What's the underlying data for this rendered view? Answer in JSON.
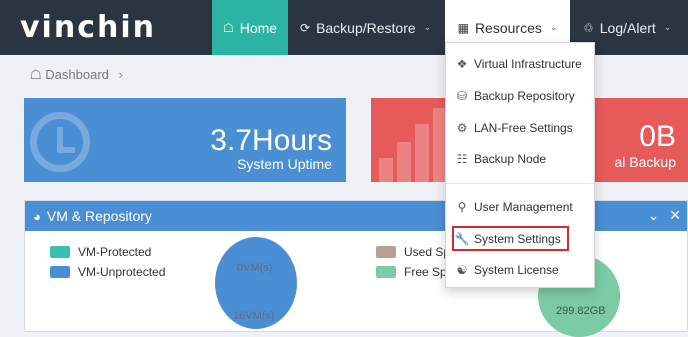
{
  "brand": {
    "logo": "vinchin"
  },
  "nav": {
    "home": "Home",
    "backup_restore": "Backup/Restore",
    "resources": "Resources",
    "log_alert": "Log/Alert"
  },
  "breadcrumb": {
    "item": "Dashboard"
  },
  "tiles": {
    "uptime_value": "3.7Hours",
    "uptime_label": "System Uptime",
    "backup_value": "0B",
    "backup_label": "al Backup"
  },
  "panel": {
    "title": "VM & Repository",
    "legend": {
      "protected": "VM-Protected",
      "unprotected": "VM-Unprotected",
      "used": "Used Sp",
      "free": "Free Spa"
    },
    "vm_protected_count": "0VM(s)",
    "vm_unprotected_count": "16VM(s)",
    "free_space": "299.82GB",
    "colors": {
      "protected": "#3bbfae",
      "unprotected": "#4a8ed3",
      "used": "#b79f95",
      "free": "#7bcba6"
    }
  },
  "resources_menu": {
    "items": [
      {
        "label": "Virtual Infrastructure",
        "icon": "cube-icon"
      },
      {
        "label": "Backup Repository",
        "icon": "database-icon"
      },
      {
        "label": "LAN-Free Settings",
        "icon": "cogs-icon"
      },
      {
        "label": "Backup Node",
        "icon": "sitemap-icon"
      },
      {
        "label": "User Management",
        "icon": "user-icon"
      },
      {
        "label": "System Settings",
        "icon": "wrench-icon"
      },
      {
        "label": "System License",
        "icon": "users-icon"
      }
    ],
    "highlighted": "System Settings"
  }
}
